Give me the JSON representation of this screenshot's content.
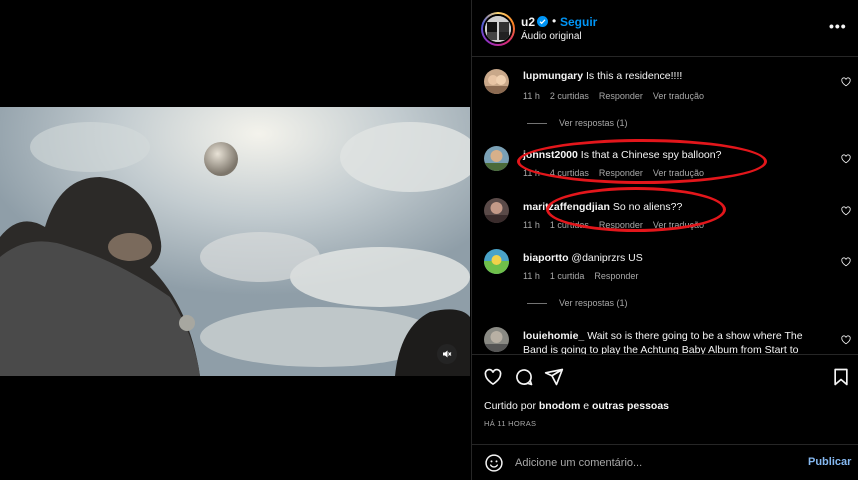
{
  "post": {
    "username": "u2",
    "follow_label": "Seguir",
    "dot": "•",
    "audio_label": "Áudio original",
    "more_label": "•••"
  },
  "comments": [
    {
      "user": "lupmungary",
      "text": "Is this a residence!!!!",
      "time": "11 h",
      "likes": "2 curtidas",
      "reply": "Responder",
      "translate": "Ver tradução",
      "replies": "Ver respostas (1)"
    },
    {
      "user": "johnst2000",
      "text": "Is that a Chinese spy balloon?",
      "time": "11 h",
      "likes": "4 curtidas",
      "reply": "Responder",
      "translate": "Ver tradução"
    },
    {
      "user": "maritzaffengdjian",
      "text": "So no aliens??",
      "time": "11 h",
      "likes": "1 curtidas",
      "reply": "Responder",
      "translate": "Ver tradução"
    },
    {
      "user": "biaportto",
      "text": "@daniprzrs US",
      "time": "11 h",
      "likes": "1 curtida",
      "reply": "Responder",
      "replies": "Ver respostas (1)"
    },
    {
      "user": "louiehomie_",
      "text": "Wait so is there going to be a show where The Band is going to play the Achtung Baby Album from Start to"
    }
  ],
  "likes": {
    "prefix": "Curtido por",
    "user": "bnodom",
    "conj": "e",
    "others": "outras pessoas"
  },
  "timestamp": "HÁ 11 HORAS",
  "add_comment": {
    "placeholder": "Adicione um comentário...",
    "publish_label": "Publicar"
  },
  "colors": {
    "accent": "#0095f6",
    "annotation": "#e3161b",
    "background": "#000000"
  }
}
